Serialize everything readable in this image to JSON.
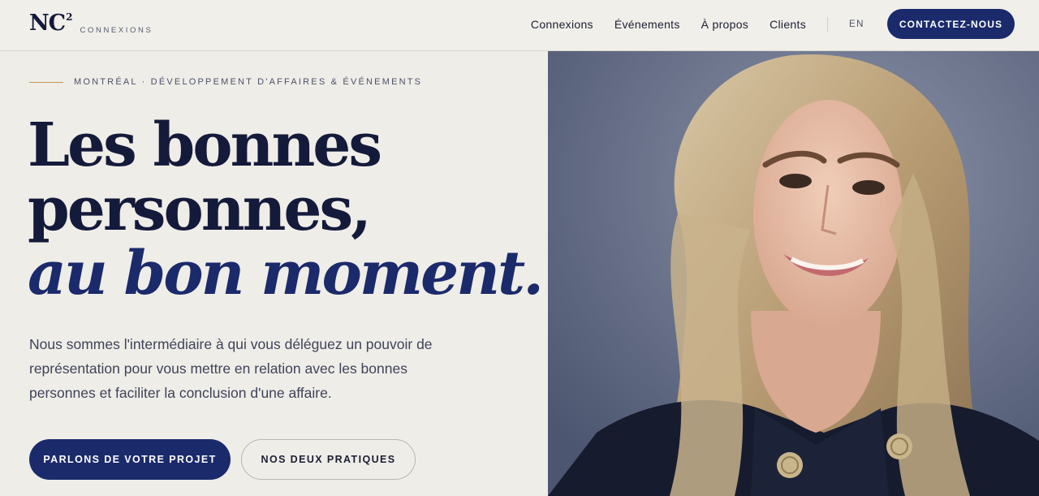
{
  "header": {
    "logo_mark": "NC",
    "logo_sup": "2",
    "logo_sub": "CONNEXIONS",
    "nav": [
      "Connexions",
      "Événements",
      "À propos",
      "Clients"
    ],
    "lang": "EN",
    "contact_label": "CONTACTEZ-NOUS"
  },
  "hero": {
    "eyebrow": "MONTRÉAL · DÉVELOPPEMENT D'AFFAIRES & ÉVÉNEMENTS",
    "headline_line1": "Les bonnes",
    "headline_line2": "personnes,",
    "headline_line3": "au bon moment.",
    "intro_line1": "Nous sommes l'intermédiaire à qui vous déléguez un pouvoir de",
    "intro_line2": "représentation pour vous mettre en relation avec les bonnes",
    "intro_line3": "personnes et faciliter la conclusion d'une affaire.",
    "cta_primary": "PARLONS DE VOTRE PROJET",
    "cta_secondary": "NOS DEUX PRATIQUES"
  },
  "colors": {
    "navy": "#1b2a6b",
    "ink": "#141a3a",
    "background": "#efede8",
    "accent_line": "#c8964f"
  }
}
